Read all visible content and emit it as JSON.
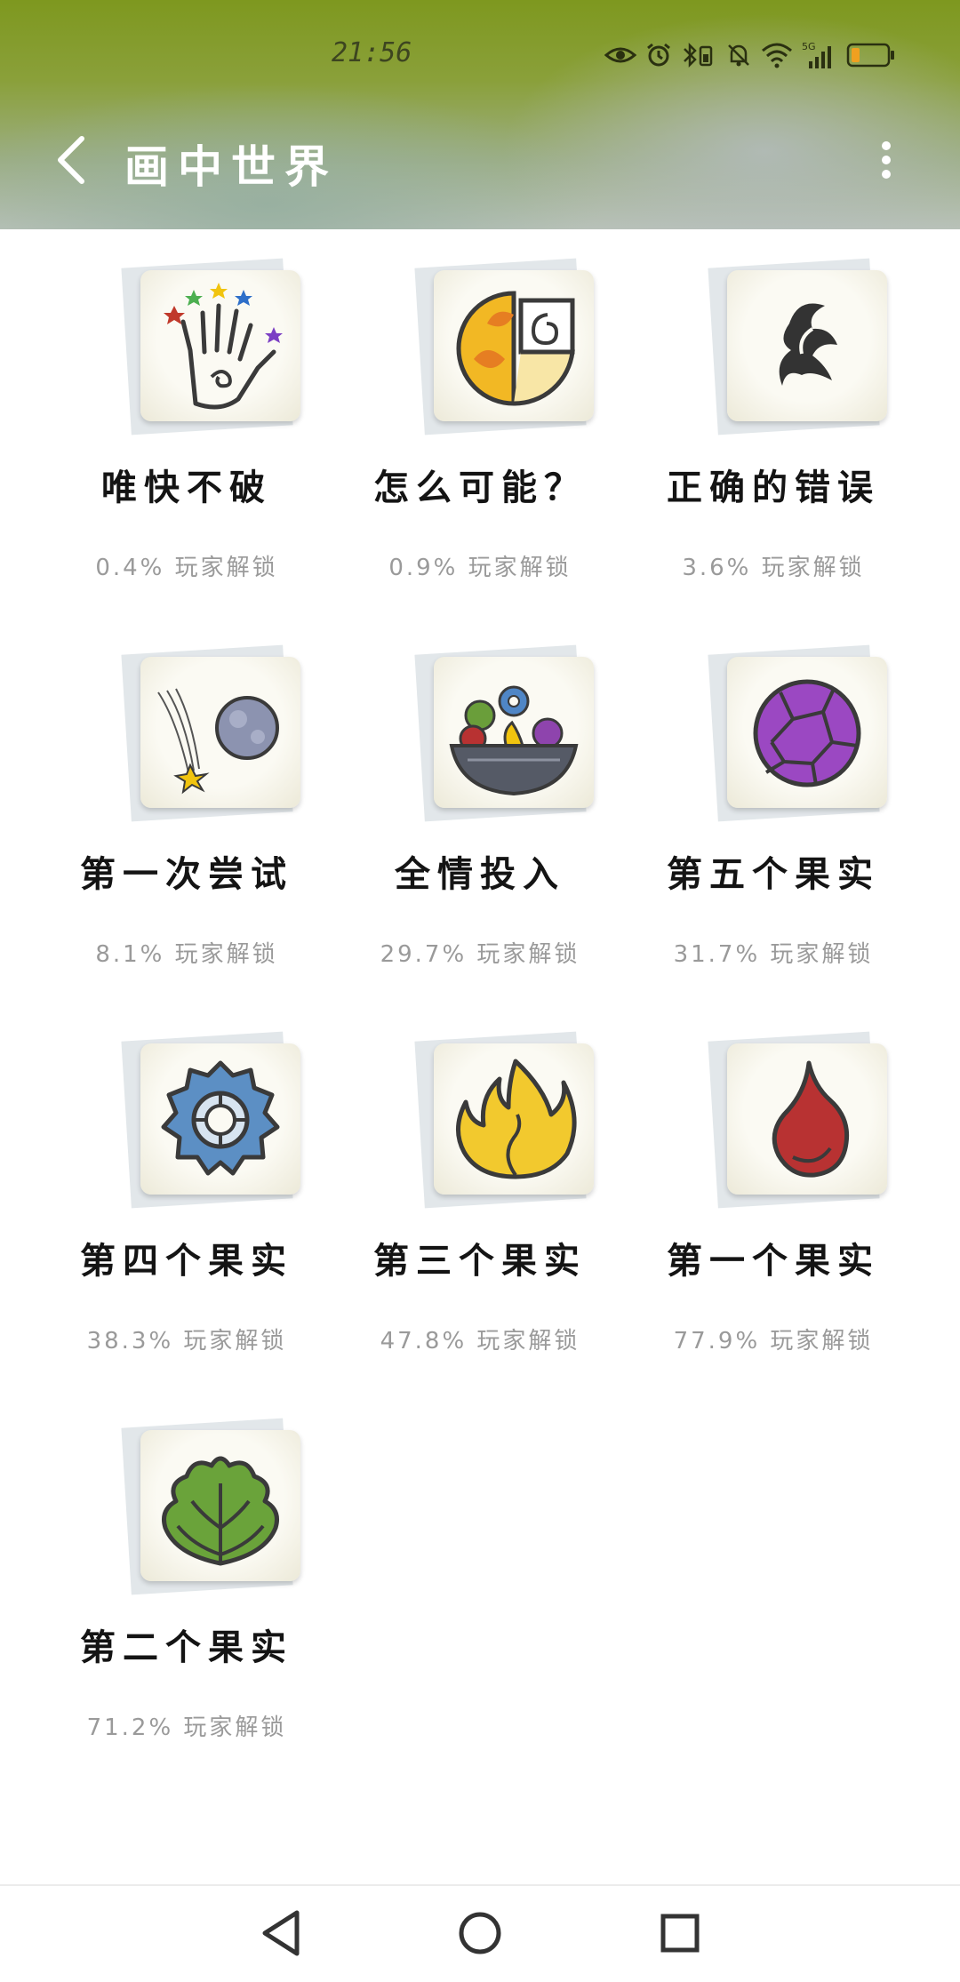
{
  "status_bar": {
    "time": "21:56",
    "icons": [
      "eye-icon",
      "alarm-icon",
      "bluetooth-icon",
      "mute-icon",
      "wifi-icon",
      "signal-5g-icon",
      "battery-icon"
    ],
    "battery_color": "#f0a020"
  },
  "header": {
    "back_icon": "chevron-left-icon",
    "title": "画中世界",
    "more_icon": "more-vertical-icon",
    "gradient_top": "#7e981f",
    "gradient_bottom": "#b9c2b9"
  },
  "achievements": [
    {
      "title": "唯快不破",
      "rate": "0.4% 玩家解锁",
      "icon": "hand-stars-icon"
    },
    {
      "title": "怎么可能？",
      "rate": "0.9% 玩家解锁",
      "icon": "fire-swirl-icon"
    },
    {
      "title": "正确的错误",
      "rate": "3.6% 玩家解锁",
      "icon": "smoke-swirl-icon"
    },
    {
      "title": "第一次尝试",
      "rate": "8.1% 玩家解锁",
      "icon": "rolling-stone-icon"
    },
    {
      "title": "全情投入",
      "rate": "29.7% 玩家解锁",
      "icon": "fruit-bowl-icon"
    },
    {
      "title": "第五个果实",
      "rate": "31.7% 玩家解锁",
      "icon": "purple-fruit-icon"
    },
    {
      "title": "第四个果实",
      "rate": "38.3% 玩家解锁",
      "icon": "blue-gear-fruit-icon"
    },
    {
      "title": "第三个果实",
      "rate": "47.8% 玩家解锁",
      "icon": "yellow-flame-fruit-icon"
    },
    {
      "title": "第一个果实",
      "rate": "77.9% 玩家解锁",
      "icon": "red-drop-fruit-icon"
    },
    {
      "title": "第二个果实",
      "rate": "71.2% 玩家解锁",
      "icon": "green-leaf-fruit-icon"
    }
  ],
  "navbar": {
    "items": [
      "back-triangle-icon",
      "home-circle-icon",
      "recents-square-icon"
    ]
  }
}
